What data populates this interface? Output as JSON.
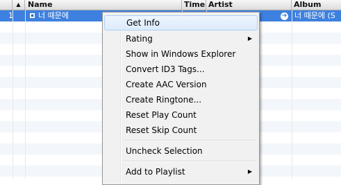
{
  "header": {
    "num_col": "",
    "sort_icon": "triangle-up",
    "name": "Name",
    "time": "Time",
    "artist": "Artist",
    "album": "Album"
  },
  "rows": [
    {
      "index": "1",
      "name": "너 때문에",
      "artist_partial": "",
      "album": "너 때문에 (S"
    }
  ],
  "menu": {
    "items": [
      {
        "label": "Get Info",
        "highlighted": true
      },
      {
        "label": "Rating",
        "submenu": true
      },
      {
        "label": "Show in Windows Explorer"
      },
      {
        "label": "Convert ID3 Tags..."
      },
      {
        "label": "Create AAC Version"
      },
      {
        "label": "Create Ringtone..."
      },
      {
        "label": "Reset Play Count"
      },
      {
        "label": "Reset Skip Count"
      },
      {
        "label": "Uncheck Selection"
      },
      {
        "label": "Add to Playlist",
        "submenu": true
      }
    ],
    "submenu_glyph": "▶"
  },
  "colors": {
    "selection": "#3d80df",
    "menu_bg": "#f1f1f1",
    "highlight_border": "#aecff7"
  }
}
